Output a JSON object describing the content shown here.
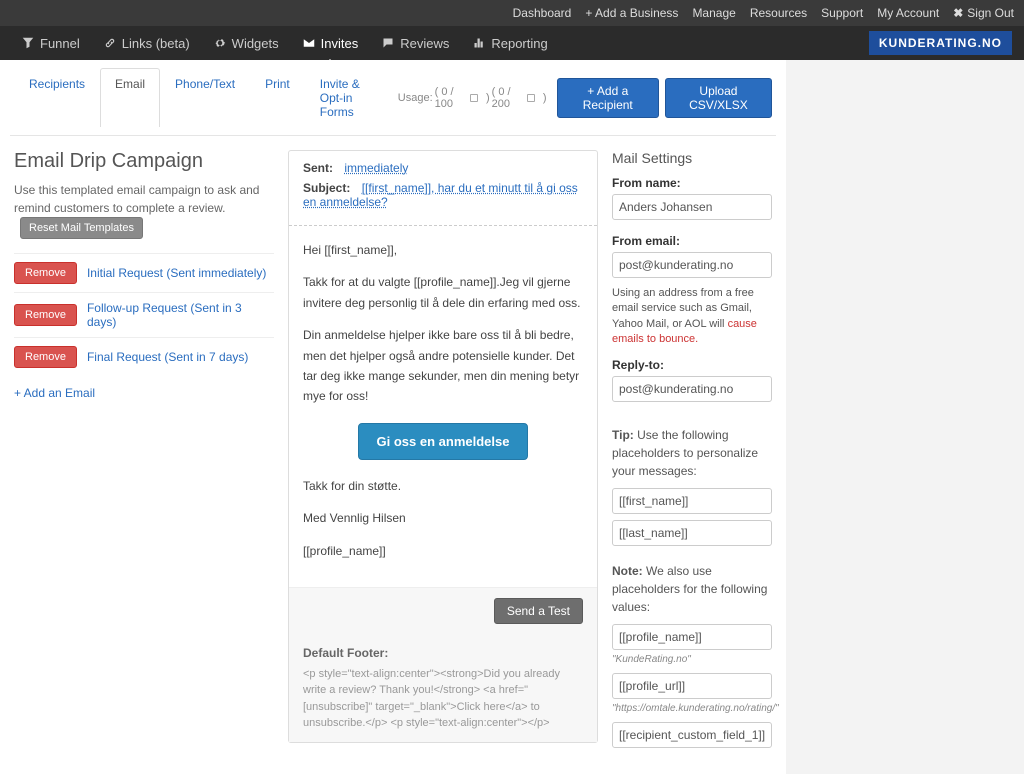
{
  "topbar": {
    "dashboard": "Dashboard",
    "add_business": "+ Add a Business",
    "manage": "Manage",
    "resources": "Resources",
    "support": "Support",
    "my_account": "My Account",
    "sign_out": "Sign Out"
  },
  "nav": {
    "funnel": "Funnel",
    "links": "Links (beta)",
    "widgets": "Widgets",
    "invites": "Invites",
    "reviews": "Reviews",
    "reporting": "Reporting",
    "brand": "KUNDERATING.NO"
  },
  "usage": {
    "label": "Usage:",
    "email": "( 0 / 100",
    "email_suffix": ")",
    "sms": "( 0 / 200",
    "sms_suffix": ")"
  },
  "tabs": {
    "recipients": "Recipients",
    "email": "Email",
    "phone": "Phone/Text",
    "print": "Print",
    "optin": "Invite & Opt-in Forms"
  },
  "actions": {
    "add_recipient": "+ Add a Recipient",
    "upload": "Upload CSV/XLSX"
  },
  "left": {
    "title": "Email Drip Campaign",
    "desc": "Use this templated email campaign to ask and remind customers to complete a review.",
    "reset": "Reset Mail Templates",
    "remove": "Remove",
    "steps": [
      "Initial Request (Sent immediately)",
      "Follow-up Request (Sent in 3 days)",
      "Final Request (Sent in 7 days)"
    ],
    "add": "+ Add an Email"
  },
  "editor": {
    "sent_label": "Sent:",
    "sent_value": "immediately",
    "subject_label": "Subject:",
    "subject_value": "[[first_name]], har du et minutt til å gi oss en anmeldelse?",
    "p1": "Hei [[first_name]],",
    "p2": "Takk for at du valgte [[profile_name]].Jeg vil gjerne invitere deg personlig til å dele din erfaring med oss.",
    "p3": "Din anmeldelse hjelper ikke bare oss til å bli bedre, men det hjelper også andre potensielle kunder. Det tar deg ikke mange sekunder, men din mening betyr mye for oss!",
    "cta": "Gi oss en anmeldelse",
    "p4": "Takk for din støtte.",
    "p5": "Med Vennlig Hilsen",
    "p6": "[[profile_name]]",
    "send_test": "Send a Test",
    "footer_label": "Default Footer:",
    "footer_text": "<p style=\"text-align:center\"><strong>Did you already write a review? Thank you!</strong> <a href=\"[unsubscribe]\" target=\"_blank\">Click here</a> to unsubscribe.</p> <p style=\"text-align:center\"></p>"
  },
  "settings": {
    "title": "Mail Settings",
    "from_name_label": "From name:",
    "from_name": "Anders Johansen",
    "from_email_label": "From email:",
    "from_email": "post@kunderating.no",
    "warn_part1": "Using an address from a free email service such as Gmail, Yahoo Mail, or AOL will ",
    "warn_part2": "cause emails to bounce",
    "reply_label": "Reply-to:",
    "reply_to": "post@kunderating.no",
    "tip_label": "Tip:",
    "tip_text": " Use the following placeholders to personalize your messages:",
    "note_label": "Note:",
    "note_text": " We also use placeholders for the following values:",
    "ph_first": "[[first_name]]",
    "ph_last": "[[last_name]]",
    "ph_profile": "[[profile_name]]",
    "ph_profile_sub": "\"KundeRating.no\"",
    "ph_url": "[[profile_url]]",
    "ph_url_sub": "\"https://omtale.kunderating.no/rating/\"",
    "ph_custom": "[[recipient_custom_field_1]]"
  }
}
